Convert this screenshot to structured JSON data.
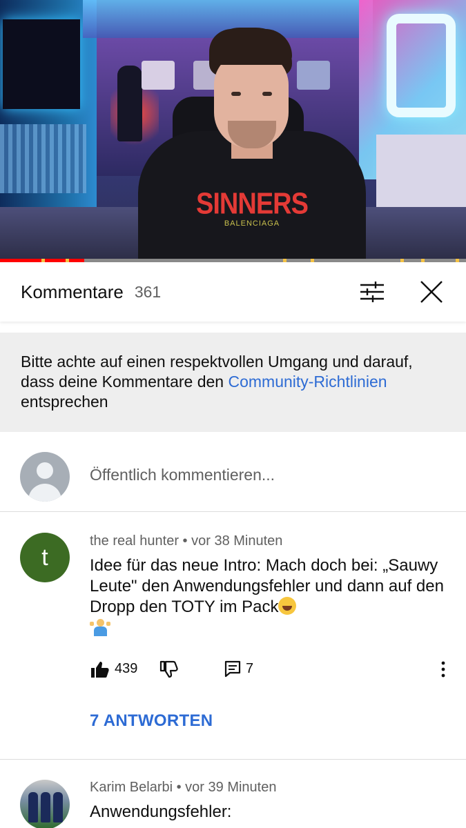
{
  "video": {
    "shirt_text": "SINNERS",
    "shirt_subtext": "BALENCIAGA",
    "progress_fraction": 0.18
  },
  "comments_header": {
    "title": "Kommentare",
    "count": "361",
    "filter_icon": "filter-sliders-icon",
    "close_icon": "close-icon"
  },
  "notice": {
    "text_before": "Bitte achte auf einen respektvollen Umgang und darauf, dass deine Kommentare den ",
    "link": "Community-Richtlinien",
    "text_after": " entsprechen"
  },
  "add_comment": {
    "placeholder": "Öffentlich kommentieren..."
  },
  "comments": [
    {
      "avatar_letter": "t",
      "author": "the real hunter",
      "time": "vor 38 Minuten",
      "text": "Idee für das neue Intro: Mach doch bei: „Sauwy Leute\" den Anwendungsfehler und dann auf den Dropp den TOTY im Pack",
      "likes": "439",
      "replies_count": "7",
      "replies_link": "7 ANTWORTEN"
    },
    {
      "author": "Karim Belarbi",
      "time": "vor 39 Minuten",
      "text": "Anwendungsfehler:"
    }
  ],
  "colors": {
    "link_blue": "#2d6bd4",
    "progress_red": "#ff0000",
    "avatar_green": "#3c6b23"
  }
}
